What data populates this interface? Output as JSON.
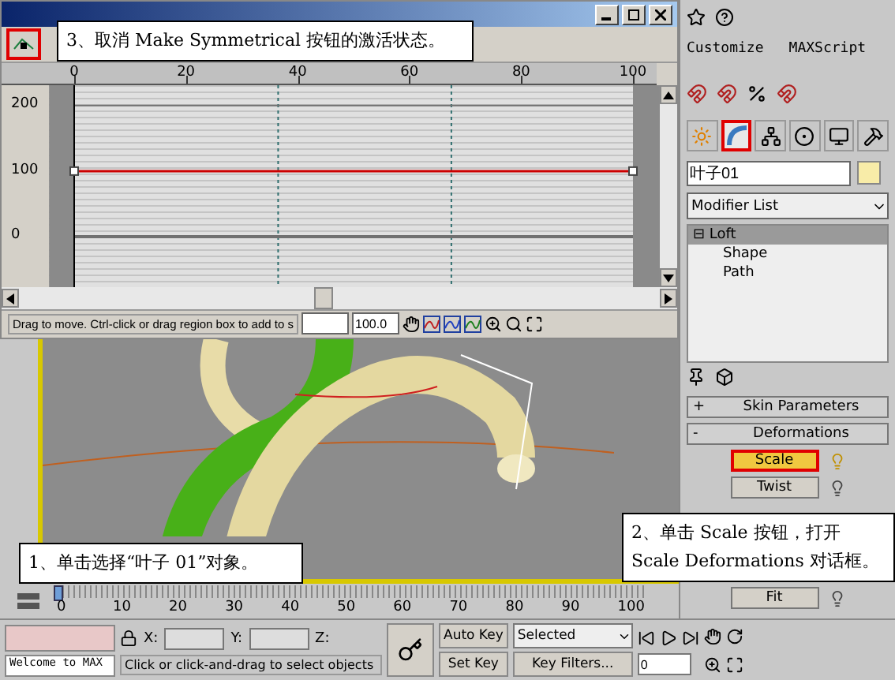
{
  "curve_dialog": {
    "status": "Drag to move. Ctrl-click or drag region box to add to s",
    "field_2": "100.0",
    "chart_data": {
      "type": "line",
      "x": [
        0,
        100
      ],
      "series": [
        {
          "color": "#cc0000",
          "marker": "square",
          "values": [
            100,
            100
          ]
        }
      ],
      "xlim": [
        0,
        100
      ],
      "ylim": [
        -77,
        231
      ],
      "xticks": [
        0,
        20,
        40,
        60,
        80,
        100
      ],
      "yticks": [
        0,
        100,
        200
      ],
      "ref_lines": [
        {
          "axis": "x",
          "value": 36.5
        },
        {
          "axis": "x",
          "value": 67.5
        },
        {
          "axis": "y",
          "value": 200
        },
        {
          "axis": "y",
          "value": 0
        }
      ],
      "bands": [
        {
          "axis": "x",
          "from": -4.5,
          "to": 0
        },
        {
          "axis": "x",
          "from": 100,
          "to": 104.8
        }
      ]
    }
  },
  "annotations": [
    {
      "lines": [
        "3、取消 Make Symmetrical 按钮的激活状态。"
      ]
    },
    {
      "lines": [
        "1、单击选择“叶子 01”对象。"
      ]
    },
    {
      "lines": [
        "2、单击 Scale 按钮，打开",
        "Scale Deformations 对话框。"
      ]
    }
  ],
  "menu": [
    "Customize",
    "MAXScript"
  ],
  "command_tabs": [
    {
      "kind": "create",
      "selected": false
    },
    {
      "kind": "modify",
      "selected": true
    },
    {
      "kind": "hierarchy",
      "selected": false
    },
    {
      "kind": "motion",
      "selected": false
    },
    {
      "kind": "display",
      "selected": false
    },
    {
      "kind": "utilities",
      "selected": false
    }
  ],
  "object_name": "叶子01",
  "modifier_list": "Modifier List",
  "stack": [
    {
      "label": "Loft",
      "sign": "⊟",
      "selected": true,
      "children": [
        {
          "label": "Shape",
          "selected": false
        },
        {
          "label": "Path",
          "selected": false
        }
      ]
    }
  ],
  "rollouts": [
    {
      "sign": "+",
      "title": "Skin Parameters"
    },
    {
      "sign": "-",
      "title": "Deformations"
    }
  ],
  "deformations": [
    {
      "label": "Scale",
      "active": true
    },
    {
      "label": "Twist",
      "active": false
    },
    {
      "label": "Fit",
      "active": false
    }
  ],
  "timeline": {
    "labels": [
      "0",
      "10",
      "20",
      "30",
      "40",
      "50",
      "60",
      "70",
      "80",
      "90",
      "100"
    ],
    "level": 0
  },
  "bottom": {
    "welcome": "Welcome to MAX",
    "prompt": "Click or click-and-drag to select objects",
    "x_label": "X:",
    "y_label": "Y:",
    "z_label": "Z:",
    "auto_key": "Auto Key",
    "set_key": "Set Key",
    "selection": "Selected",
    "key_filters": "Key Filters...",
    "frame": "0"
  }
}
